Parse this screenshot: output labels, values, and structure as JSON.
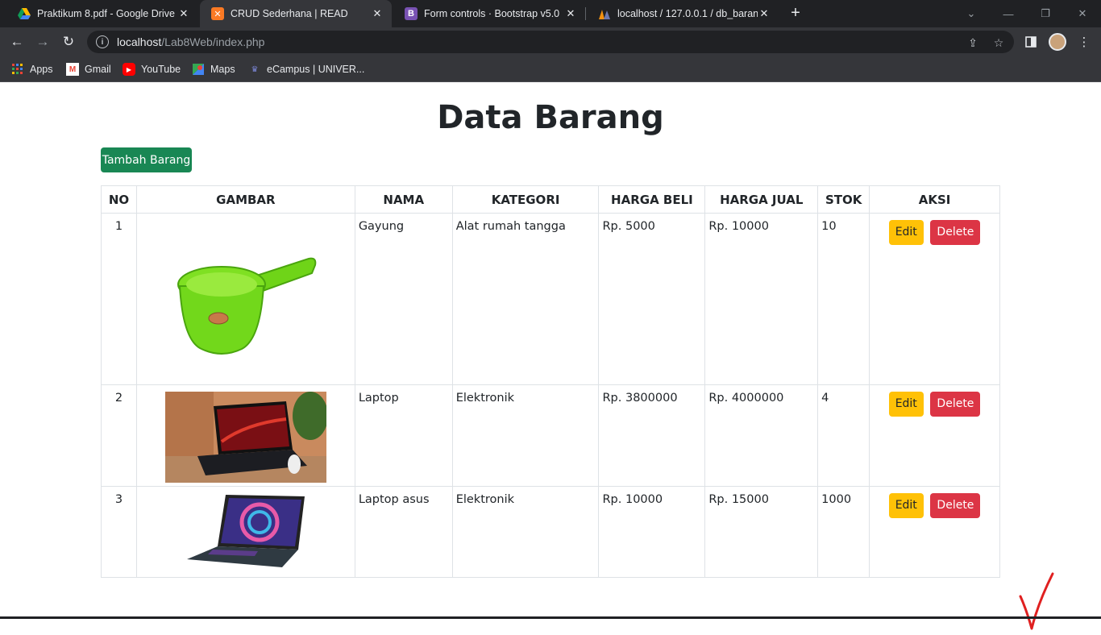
{
  "browser": {
    "tabs": [
      {
        "title": "Praktikum 8.pdf - Google Drive",
        "icon": "google-drive-icon"
      },
      {
        "title": "CRUD Sederhana | READ",
        "icon": "xampp-icon"
      },
      {
        "title": "Form controls · Bootstrap v5.0",
        "icon": "bootstrap-icon"
      },
      {
        "title": "localhost / 127.0.0.1 / db_barang",
        "icon": "phpmyadmin-icon"
      }
    ],
    "url_host": "localhost",
    "url_path": "/Lab8Web/index.php",
    "bookmarks": [
      {
        "label": "Apps",
        "icon": "apps-grid-icon"
      },
      {
        "label": "Gmail",
        "icon": "gmail-icon"
      },
      {
        "label": "YouTube",
        "icon": "youtube-icon"
      },
      {
        "label": "Maps",
        "icon": "maps-icon"
      },
      {
        "label": "eCampus | UNIVER...",
        "icon": "ecampus-icon"
      }
    ]
  },
  "page": {
    "title": "Data Barang",
    "add_button": "Tambah Barang",
    "columns": [
      "NO",
      "GAMBAR",
      "NAMA",
      "KATEGORI",
      "HARGA BELI",
      "HARGA JUAL",
      "STOK",
      "AKSI"
    ],
    "rows": [
      {
        "no": "1",
        "image": "gayung-image",
        "nama": "Gayung",
        "kategori": "Alat rumah tangga",
        "harga_beli": "Rp. 5000",
        "harga_jual": "Rp. 10000",
        "stok": "10"
      },
      {
        "no": "2",
        "image": "laptop-image",
        "nama": "Laptop",
        "kategori": "Elektronik",
        "harga_beli": "Rp. 3800000",
        "harga_jual": "Rp. 4000000",
        "stok": "4"
      },
      {
        "no": "3",
        "image": "laptop-asus-image",
        "nama": "Laptop asus",
        "kategori": "Elektronik",
        "harga_beli": "Rp. 10000",
        "harga_jual": "Rp. 15000",
        "stok": "1000"
      }
    ],
    "edit_label": "Edit",
    "delete_label": "Delete"
  },
  "colors": {
    "success": "#198754",
    "warning": "#ffc107",
    "danger": "#dc3545",
    "annotation": "#e02020"
  }
}
